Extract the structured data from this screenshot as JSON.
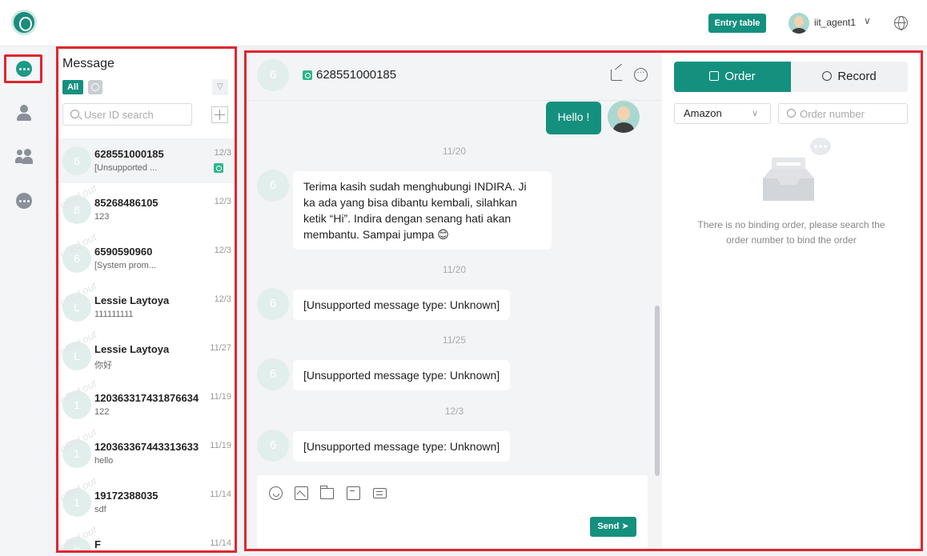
{
  "header": {
    "entry_button": "Entry table",
    "username": "iit_agent1"
  },
  "message_panel": {
    "title": "Message",
    "filter_all": "All",
    "search_placeholder": "User ID search",
    "watermark": "olled out",
    "conversations": [
      {
        "avatar": "6",
        "name": "628551000185",
        "preview": "[Unsupported ...",
        "time": "12/3",
        "whatsapp": true,
        "active": true
      },
      {
        "avatar": "8",
        "name": "85268486105",
        "preview": "123",
        "time": "12/3"
      },
      {
        "avatar": "6",
        "name": "6590590960",
        "preview": "[System prom...",
        "time": "12/3"
      },
      {
        "avatar": "L",
        "name": "Lessie Laytoya",
        "preview": "111111111",
        "time": "12/3"
      },
      {
        "avatar": "L",
        "name": "Lessie Laytoya",
        "preview": "你好",
        "time": "11/27"
      },
      {
        "avatar": "1",
        "name": "120363317431876634",
        "preview": "122",
        "time": "11/19"
      },
      {
        "avatar": "1",
        "name": "120363367443313633",
        "preview": "hello",
        "time": "11/19"
      },
      {
        "avatar": "1",
        "name": "19172388035",
        "preview": "sdf",
        "time": "11/14"
      },
      {
        "avatar": "F",
        "name": "F",
        "preview": "",
        "time": "11/14"
      }
    ]
  },
  "chat": {
    "contact_avatar": "6",
    "contact_name": "628551000185",
    "outgoing": "Hello !",
    "timeline": [
      {
        "date": "11/20",
        "text": "Terima kasih sudah menghubungi INDIRA. Ji ka ada yang bisa dibantu kembali, silahkan ketik “Hi”. Indira dengan senang hati akan membantu. Sampai jumpa 😊"
      },
      {
        "date": "11/20",
        "text": "[Unsupported message type: Unknown]"
      },
      {
        "date": "11/25",
        "text": "[Unsupported message type: Unknown]"
      },
      {
        "date": "12/3",
        "text": "[Unsupported message type: Unknown]"
      }
    ],
    "send_label": "Send ➤"
  },
  "side_panel": {
    "tab_order": "Order",
    "tab_record": "Record",
    "platform_selected": "Amazon",
    "order_search_placeholder": "Order number",
    "empty_text": "There is no binding order, please search the order number to bind the order"
  },
  "colors": {
    "accent": "#15907f",
    "highlight_border": "#e0262e"
  }
}
